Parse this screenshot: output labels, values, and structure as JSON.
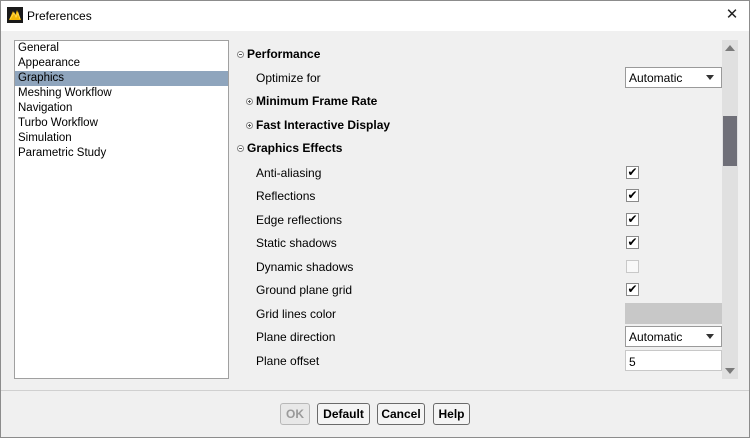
{
  "window": {
    "title": "Preferences"
  },
  "nav": {
    "items": [
      "General",
      "Appearance",
      "Graphics",
      "Meshing Workflow",
      "Navigation",
      "Turbo Workflow",
      "Simulation",
      "Parametric Study"
    ],
    "selected": "Graphics"
  },
  "sections": {
    "performance": "Performance",
    "min_frame_rate": "Minimum Frame Rate",
    "fast_interactive": "Fast Interactive Display",
    "graphics_effects": "Graphics Effects"
  },
  "props": {
    "optimize_for": {
      "label": "Optimize for",
      "value": "Automatic"
    },
    "anti_aliasing": {
      "label": "Anti-aliasing",
      "checked": true
    },
    "reflections": {
      "label": "Reflections",
      "checked": true
    },
    "edge_reflections": {
      "label": "Edge reflections",
      "checked": true
    },
    "static_shadows": {
      "label": "Static shadows",
      "checked": true
    },
    "dynamic_shadows": {
      "label": "Dynamic shadows",
      "checked": false
    },
    "ground_plane_grid": {
      "label": "Ground plane grid",
      "checked": true
    },
    "grid_lines_color": {
      "label": "Grid lines color",
      "color": "#c8c8c8"
    },
    "plane_direction": {
      "label": "Plane direction",
      "value": "Automatic"
    },
    "plane_offset": {
      "label": "Plane offset",
      "value": "5"
    }
  },
  "check_glyph": "✔",
  "close_glyph": "✕",
  "buttons": {
    "ok": "OK",
    "default": "Default",
    "cancel": "Cancel",
    "help": "Help"
  },
  "colors": {
    "selection": "#8fa5bd",
    "scroll_thumb": "#6f6f78"
  }
}
